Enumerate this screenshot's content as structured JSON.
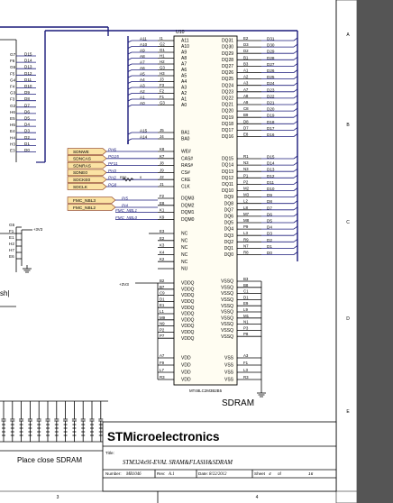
{
  "ic": {
    "ref": "U10",
    "part": "MT48LC2M3B2B5",
    "name": "SDRAM",
    "left_pins": [
      {
        "name": "A11",
        "num": "I1"
      },
      {
        "name": "A10",
        "num": "G2"
      },
      {
        "name": "A9",
        "num": "G1"
      },
      {
        "name": "A8",
        "num": "H1"
      },
      {
        "name": "A7",
        "num": "H2"
      },
      {
        "name": "A6",
        "num": "G3"
      },
      {
        "name": "A5",
        "num": "H3"
      },
      {
        "name": "A4",
        "num": "J3"
      },
      {
        "name": "A3",
        "num": "F3"
      },
      {
        "name": "A2",
        "num": "F2"
      },
      {
        "name": "A1",
        "num": "F1"
      },
      {
        "name": "A0",
        "num": "G3"
      },
      {
        "name": "BA1",
        "num": "J5"
      },
      {
        "name": "BA0",
        "num": "J4"
      },
      {
        "name": "WE#",
        "num": "K8"
      },
      {
        "name": "CAS#",
        "num": "K7"
      },
      {
        "name": "RAS#",
        "num": "J8"
      },
      {
        "name": "CS#",
        "num": "J9"
      },
      {
        "name": "CKE",
        "num": "J2"
      },
      {
        "name": "CLK",
        "num": "J1"
      },
      {
        "name": "DQM3",
        "num": "F2"
      },
      {
        "name": "DQM2",
        "num": "E8"
      },
      {
        "name": "DQM1",
        "num": "K1"
      },
      {
        "name": "DQM0",
        "num": "K9"
      },
      {
        "name": "NC",
        "num": "E3"
      },
      {
        "name": "NC",
        "num": "E2"
      },
      {
        "name": "NC",
        "num": "K3"
      },
      {
        "name": "NC",
        "num": "K4"
      },
      {
        "name": "NC",
        "num": "K2"
      },
      {
        "name": "NU",
        "num": ""
      },
      {
        "name": "VDDQ",
        "num": "B2"
      },
      {
        "name": "VDDQ",
        "num": "B7"
      },
      {
        "name": "VDDQ",
        "num": "C9"
      },
      {
        "name": "VDDQ",
        "num": "D1"
      },
      {
        "name": "VDDQ",
        "num": "E1"
      },
      {
        "name": "VDDQ",
        "num": "L1"
      },
      {
        "name": "VDDQ",
        "num": "M9"
      },
      {
        "name": "VDDQ",
        "num": "N9"
      },
      {
        "name": "VDDQ",
        "num": "P2"
      },
      {
        "name": "VDDQ",
        "num": "P7"
      },
      {
        "name": "VDD",
        "num": "A7"
      },
      {
        "name": "VDD",
        "num": "F9"
      },
      {
        "name": "VDD",
        "num": "L7"
      },
      {
        "name": "VDD",
        "num": "R3"
      }
    ],
    "right_pins": [
      {
        "name": "DQ31",
        "num": "E2",
        "net": "D31"
      },
      {
        "name": "DQ30",
        "num": "D3",
        "net": "D30"
      },
      {
        "name": "DQ29",
        "num": "D2",
        "net": "D29"
      },
      {
        "name": "DQ28",
        "num": "B1",
        "net": "D28"
      },
      {
        "name": "DQ27",
        "num": "B3",
        "net": "D27"
      },
      {
        "name": "DQ26",
        "num": "A1",
        "net": "D26"
      },
      {
        "name": "DQ25",
        "num": "A2",
        "net": "D25"
      },
      {
        "name": "DQ24",
        "num": "A3",
        "net": "D24"
      },
      {
        "name": "DQ23",
        "num": "A7",
        "net": "D23"
      },
      {
        "name": "DQ22",
        "num": "A8",
        "net": "D22"
      },
      {
        "name": "DQ21",
        "num": "A9",
        "net": "D21"
      },
      {
        "name": "DQ20",
        "num": "C8",
        "net": "D20"
      },
      {
        "name": "DQ19",
        "num": "B9",
        "net": "D19"
      },
      {
        "name": "DQ18",
        "num": "D8",
        "net": "D18"
      },
      {
        "name": "DQ17",
        "num": "D7",
        "net": "D17"
      },
      {
        "name": "DQ16",
        "num": "E8",
        "net": "D16"
      },
      {
        "name": "DQ15",
        "num": "R1",
        "net": "D15"
      },
      {
        "name": "DQ14",
        "num": "N3",
        "net": "D14"
      },
      {
        "name": "DQ13",
        "num": "N3",
        "net": "D13"
      },
      {
        "name": "DQ12",
        "num": "P1",
        "net": "D12"
      },
      {
        "name": "DQ11",
        "num": "P2",
        "net": "D11"
      },
      {
        "name": "DQ10",
        "num": "M2",
        "net": "D10"
      },
      {
        "name": "DQ9",
        "num": "M3",
        "net": "D9"
      },
      {
        "name": "DQ8",
        "num": "L2",
        "net": "D8"
      },
      {
        "name": "DQ7",
        "num": "L8",
        "net": "D7"
      },
      {
        "name": "DQ6",
        "num": "M7",
        "net": "D6"
      },
      {
        "name": "DQ5",
        "num": "M8",
        "net": "D5"
      },
      {
        "name": "DQ4",
        "num": "P9",
        "net": "D4"
      },
      {
        "name": "DQ3",
        "num": "L3",
        "net": "D3"
      },
      {
        "name": "DQ2",
        "num": "R9",
        "net": "D2"
      },
      {
        "name": "DQ1",
        "num": "N7",
        "net": "D1"
      },
      {
        "name": "DQ0",
        "num": "R8",
        "net": "D0"
      },
      {
        "name": "VSSQ",
        "num": "B3",
        "net": ""
      },
      {
        "name": "VSSQ",
        "num": "B8",
        "net": ""
      },
      {
        "name": "VSSQ",
        "num": "C1",
        "net": ""
      },
      {
        "name": "VSSQ",
        "num": "D1",
        "net": ""
      },
      {
        "name": "VSSQ",
        "num": "E9",
        "net": ""
      },
      {
        "name": "VSSQ",
        "num": "L9",
        "net": ""
      },
      {
        "name": "VSSQ",
        "num": "M1",
        "net": ""
      },
      {
        "name": "VSSQ",
        "num": "N1",
        "net": ""
      },
      {
        "name": "VSSQ",
        "num": "P3",
        "net": ""
      },
      {
        "name": "VSSQ",
        "num": "P8",
        "net": ""
      },
      {
        "name": "VSS",
        "num": "A3",
        "net": ""
      },
      {
        "name": "VSS",
        "num": "F1",
        "net": ""
      },
      {
        "name": "VSS",
        "num": "L3",
        "net": ""
      },
      {
        "name": "VSS",
        "num": "R3",
        "net": ""
      }
    ]
  },
  "addr_nets": [
    "A11",
    "A10",
    "A9",
    "A8",
    "A7",
    "A6",
    "A5",
    "A4",
    "A3",
    "A2",
    "A1",
    "A0",
    "A15",
    "A14"
  ],
  "ctrl_flags": [
    "SDNWE",
    "SDNCAS",
    "SDNRAS",
    "SDNE0",
    "SDCKE0",
    "SDCLK"
  ],
  "ctrl_pins": [
    "PH6",
    "PG15",
    "PF11",
    "PH3",
    "PH2",
    "PG8"
  ],
  "resistor": {
    "ref": "R50",
    "value": "0"
  },
  "nbl_flags": [
    "FMC_NBL3",
    "FMC_NBL2"
  ],
  "nbl_pins": [
    "PI5",
    "PI4"
  ],
  "nbl_nets": [
    "FMC_NBL1",
    "FMC_NBL0"
  ],
  "power": {
    "supply": "+3V3"
  },
  "left_partial": {
    "rows": [
      {
        "pin": "G7",
        "net": "D15"
      },
      {
        "pin": "F6",
        "net": "D14"
      },
      {
        "pin": "G6",
        "net": "D13"
      },
      {
        "pin": "F5",
        "net": "D12"
      },
      {
        "pin": "G4",
        "net": "D11"
      },
      {
        "pin": "F4",
        "net": "D10"
      },
      {
        "pin": "G3",
        "net": "D9"
      },
      {
        "pin": "F3",
        "net": "D8"
      },
      {
        "pin": "G2",
        "net": "D7"
      },
      {
        "pin": "H6",
        "net": "D6"
      },
      {
        "pin": "E5",
        "net": "D5"
      },
      {
        "pin": "H5",
        "net": "D4"
      },
      {
        "pin": "E4",
        "net": "D3"
      },
      {
        "pin": "H4",
        "net": "D2"
      },
      {
        "pin": "H3",
        "net": "D1"
      },
      {
        "pin": "E3",
        "net": "D0"
      }
    ],
    "lower_pins": [
      "G5",
      "F1",
      "E1",
      "H2",
      "H7",
      "E6"
    ],
    "text": "sh|"
  },
  "bottom_caption": "Place close SDRAM",
  "title_block": {
    "company": "STMicroelectronics",
    "title_label": "Title:",
    "title": "STM324x9I-EVAL SRAM&FLASH&SDRAM",
    "number_label": "Number:",
    "number": "MB1046",
    "rev_label": "Rev:",
    "rev": "A.1",
    "date_label": "Date:",
    "date": "8/22/2012",
    "sheet_label": "Sheet",
    "sheet": "4",
    "of_label": "of",
    "sheets": "16"
  },
  "border": {
    "col_marks": [
      "3",
      "4"
    ],
    "row_marks": [
      "A",
      "B",
      "C",
      "D",
      "E"
    ]
  },
  "colors": {
    "wire": "#1a1a7a",
    "ink": "#000000",
    "flag_fill": "#fbe3a4",
    "flag_edge": "#8a3b1a",
    "dark_panel": "#555555"
  }
}
